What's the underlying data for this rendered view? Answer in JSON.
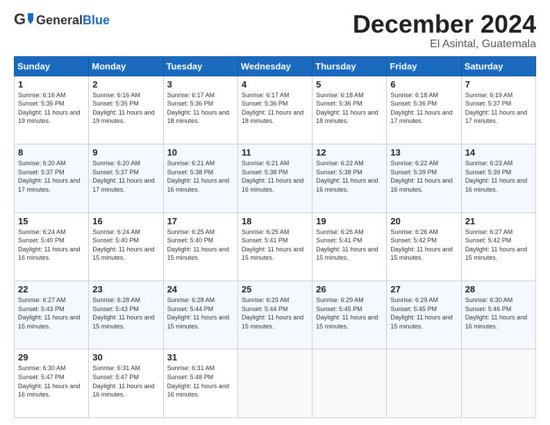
{
  "header": {
    "logo_general": "General",
    "logo_blue": "Blue",
    "month_title": "December 2024",
    "location": "El Asintal, Guatemala"
  },
  "weekdays": [
    "Sunday",
    "Monday",
    "Tuesday",
    "Wednesday",
    "Thursday",
    "Friday",
    "Saturday"
  ],
  "weeks": [
    [
      {
        "day": "1",
        "sunrise": "Sunrise: 6:16 AM",
        "sunset": "Sunset: 5:35 PM",
        "daylight": "Daylight: 11 hours and 19 minutes."
      },
      {
        "day": "2",
        "sunrise": "Sunrise: 6:16 AM",
        "sunset": "Sunset: 5:35 PM",
        "daylight": "Daylight: 11 hours and 19 minutes."
      },
      {
        "day": "3",
        "sunrise": "Sunrise: 6:17 AM",
        "sunset": "Sunset: 5:36 PM",
        "daylight": "Daylight: 11 hours and 18 minutes."
      },
      {
        "day": "4",
        "sunrise": "Sunrise: 6:17 AM",
        "sunset": "Sunset: 5:36 PM",
        "daylight": "Daylight: 11 hours and 18 minutes."
      },
      {
        "day": "5",
        "sunrise": "Sunrise: 6:18 AM",
        "sunset": "Sunset: 5:36 PM",
        "daylight": "Daylight: 11 hours and 18 minutes."
      },
      {
        "day": "6",
        "sunrise": "Sunrise: 6:18 AM",
        "sunset": "Sunset: 5:36 PM",
        "daylight": "Daylight: 11 hours and 17 minutes."
      },
      {
        "day": "7",
        "sunrise": "Sunrise: 6:19 AM",
        "sunset": "Sunset: 5:37 PM",
        "daylight": "Daylight: 11 hours and 17 minutes."
      }
    ],
    [
      {
        "day": "8",
        "sunrise": "Sunrise: 6:20 AM",
        "sunset": "Sunset: 5:37 PM",
        "daylight": "Daylight: 11 hours and 17 minutes."
      },
      {
        "day": "9",
        "sunrise": "Sunrise: 6:20 AM",
        "sunset": "Sunset: 5:37 PM",
        "daylight": "Daylight: 11 hours and 17 minutes."
      },
      {
        "day": "10",
        "sunrise": "Sunrise: 6:21 AM",
        "sunset": "Sunset: 5:38 PM",
        "daylight": "Daylight: 11 hours and 16 minutes."
      },
      {
        "day": "11",
        "sunrise": "Sunrise: 6:21 AM",
        "sunset": "Sunset: 5:38 PM",
        "daylight": "Daylight: 11 hours and 16 minutes."
      },
      {
        "day": "12",
        "sunrise": "Sunrise: 6:22 AM",
        "sunset": "Sunset: 5:38 PM",
        "daylight": "Daylight: 11 hours and 16 minutes."
      },
      {
        "day": "13",
        "sunrise": "Sunrise: 6:22 AM",
        "sunset": "Sunset: 5:39 PM",
        "daylight": "Daylight: 11 hours and 16 minutes."
      },
      {
        "day": "14",
        "sunrise": "Sunrise: 6:23 AM",
        "sunset": "Sunset: 5:39 PM",
        "daylight": "Daylight: 11 hours and 16 minutes."
      }
    ],
    [
      {
        "day": "15",
        "sunrise": "Sunrise: 6:24 AM",
        "sunset": "Sunset: 5:40 PM",
        "daylight": "Daylight: 11 hours and 16 minutes."
      },
      {
        "day": "16",
        "sunrise": "Sunrise: 6:24 AM",
        "sunset": "Sunset: 5:40 PM",
        "daylight": "Daylight: 11 hours and 15 minutes."
      },
      {
        "day": "17",
        "sunrise": "Sunrise: 6:25 AM",
        "sunset": "Sunset: 5:40 PM",
        "daylight": "Daylight: 11 hours and 15 minutes."
      },
      {
        "day": "18",
        "sunrise": "Sunrise: 6:25 AM",
        "sunset": "Sunset: 5:41 PM",
        "daylight": "Daylight: 11 hours and 15 minutes."
      },
      {
        "day": "19",
        "sunrise": "Sunrise: 6:26 AM",
        "sunset": "Sunset: 5:41 PM",
        "daylight": "Daylight: 11 hours and 15 minutes."
      },
      {
        "day": "20",
        "sunrise": "Sunrise: 6:26 AM",
        "sunset": "Sunset: 5:42 PM",
        "daylight": "Daylight: 11 hours and 15 minutes."
      },
      {
        "day": "21",
        "sunrise": "Sunrise: 6:27 AM",
        "sunset": "Sunset: 5:42 PM",
        "daylight": "Daylight: 11 hours and 15 minutes."
      }
    ],
    [
      {
        "day": "22",
        "sunrise": "Sunrise: 6:27 AM",
        "sunset": "Sunset: 5:43 PM",
        "daylight": "Daylight: 11 hours and 15 minutes."
      },
      {
        "day": "23",
        "sunrise": "Sunrise: 6:28 AM",
        "sunset": "Sunset: 5:43 PM",
        "daylight": "Daylight: 11 hours and 15 minutes."
      },
      {
        "day": "24",
        "sunrise": "Sunrise: 6:28 AM",
        "sunset": "Sunset: 5:44 PM",
        "daylight": "Daylight: 11 hours and 15 minutes."
      },
      {
        "day": "25",
        "sunrise": "Sunrise: 6:29 AM",
        "sunset": "Sunset: 5:44 PM",
        "daylight": "Daylight: 11 hours and 15 minutes."
      },
      {
        "day": "26",
        "sunrise": "Sunrise: 6:29 AM",
        "sunset": "Sunset: 5:45 PM",
        "daylight": "Daylight: 11 hours and 15 minutes."
      },
      {
        "day": "27",
        "sunrise": "Sunrise: 6:29 AM",
        "sunset": "Sunset: 5:45 PM",
        "daylight": "Daylight: 11 hours and 15 minutes."
      },
      {
        "day": "28",
        "sunrise": "Sunrise: 6:30 AM",
        "sunset": "Sunset: 5:46 PM",
        "daylight": "Daylight: 11 hours and 16 minutes."
      }
    ],
    [
      {
        "day": "29",
        "sunrise": "Sunrise: 6:30 AM",
        "sunset": "Sunset: 5:47 PM",
        "daylight": "Daylight: 11 hours and 16 minutes."
      },
      {
        "day": "30",
        "sunrise": "Sunrise: 6:31 AM",
        "sunset": "Sunset: 5:47 PM",
        "daylight": "Daylight: 11 hours and 16 minutes."
      },
      {
        "day": "31",
        "sunrise": "Sunrise: 6:31 AM",
        "sunset": "Sunset: 5:48 PM",
        "daylight": "Daylight: 11 hours and 16 minutes."
      },
      null,
      null,
      null,
      null
    ]
  ]
}
